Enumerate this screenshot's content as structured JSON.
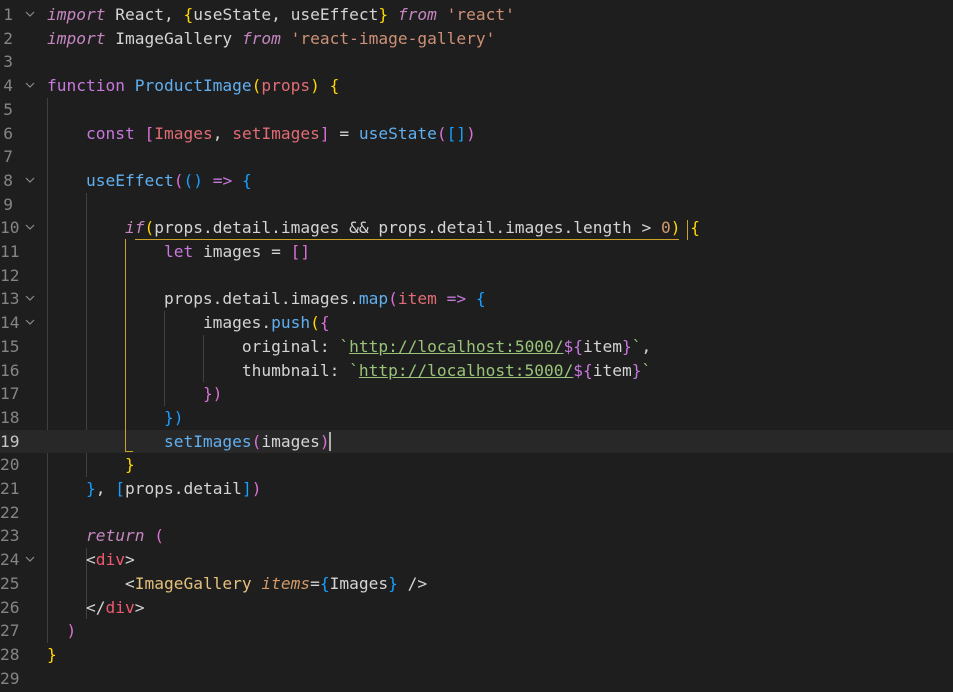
{
  "editor": {
    "language": "javascript-react",
    "active_line": 19,
    "line_numbers": [
      "1",
      "2",
      "3",
      "4",
      "5",
      "6",
      "7",
      "8",
      "9",
      "10",
      "11",
      "12",
      "13",
      "14",
      "15",
      "16",
      "17",
      "18",
      "19",
      "20",
      "21",
      "22",
      "23",
      "24",
      "25",
      "26",
      "27",
      "28",
      "29"
    ],
    "fold_markers": [
      1,
      4,
      8,
      10,
      13,
      14,
      24
    ],
    "lines": [
      [
        [
          "import",
          "kw"
        ],
        [
          " React, ",
          "plain"
        ],
        [
          "{",
          "br1"
        ],
        [
          "useState, useEffect",
          "plain"
        ],
        [
          "}",
          "br1"
        ],
        [
          " ",
          "plain"
        ],
        [
          "from",
          "kw"
        ],
        [
          " ",
          "plain"
        ],
        [
          "'react'",
          "str"
        ]
      ],
      [
        [
          "import",
          "kw"
        ],
        [
          " ImageGallery ",
          "plain"
        ],
        [
          "from",
          "kw"
        ],
        [
          " ",
          "plain"
        ],
        [
          "'react-image-gallery'",
          "str"
        ]
      ],
      [],
      [
        [
          "function",
          "let"
        ],
        [
          " ",
          "plain"
        ],
        [
          "ProductImage",
          "fn2"
        ],
        [
          "(",
          "br1"
        ],
        [
          "props",
          "param"
        ],
        [
          ")",
          "br1"
        ],
        [
          " ",
          "plain"
        ],
        [
          "{",
          "br1"
        ]
      ],
      [],
      [
        [
          "    ",
          "plain"
        ],
        [
          "const",
          "let"
        ],
        [
          " ",
          "plain"
        ],
        [
          "[",
          "br2"
        ],
        [
          "Images",
          "param"
        ],
        [
          ", ",
          "plain"
        ],
        [
          "setImages",
          "param"
        ],
        [
          "]",
          "br2"
        ],
        [
          " = ",
          "plain"
        ],
        [
          "useState",
          "fn2"
        ],
        [
          "(",
          "br2"
        ],
        [
          "[]",
          "br3"
        ],
        [
          ")",
          "br2"
        ]
      ],
      [],
      [
        [
          "    ",
          "plain"
        ],
        [
          "useEffect",
          "fn2"
        ],
        [
          "(",
          "br2"
        ],
        [
          "()",
          "br3"
        ],
        [
          " => ",
          "let"
        ],
        [
          "{",
          "br3"
        ]
      ],
      [],
      [
        [
          "        ",
          "plain"
        ],
        [
          "if",
          "kw"
        ],
        [
          "(",
          "br1"
        ],
        [
          "props.detail.images && props.detail.images.length > ",
          "plain"
        ],
        [
          "0",
          "num"
        ],
        [
          ")",
          "br1"
        ],
        [
          " ",
          "plain"
        ],
        [
          "{",
          "br1"
        ]
      ],
      [
        [
          "            ",
          "plain"
        ],
        [
          "let",
          "let"
        ],
        [
          " images = ",
          "plain"
        ],
        [
          "[]",
          "br2"
        ]
      ],
      [],
      [
        [
          "            ",
          "plain"
        ],
        [
          "props.detail.images.",
          "plain"
        ],
        [
          "map",
          "fn2"
        ],
        [
          "(",
          "br2"
        ],
        [
          "item",
          "param"
        ],
        [
          " => ",
          "let"
        ],
        [
          "{",
          "br3"
        ]
      ],
      [
        [
          "                ",
          "plain"
        ],
        [
          "images.",
          "plain"
        ],
        [
          "push",
          "fn2"
        ],
        [
          "(",
          "br1"
        ],
        [
          "{",
          "br2"
        ]
      ],
      [
        [
          "                    ",
          "plain"
        ],
        [
          "original: ",
          "plain"
        ],
        [
          "`",
          "tpl"
        ],
        [
          "http://localhost:5000/",
          "url"
        ],
        [
          "${",
          "let"
        ],
        [
          "item",
          "plain"
        ],
        [
          "}",
          "let"
        ],
        [
          "`",
          "tpl"
        ],
        [
          ",",
          "plain"
        ]
      ],
      [
        [
          "                    ",
          "plain"
        ],
        [
          "thumbnail: ",
          "plain"
        ],
        [
          "`",
          "tpl"
        ],
        [
          "http://localhost:5000/",
          "url"
        ],
        [
          "${",
          "let"
        ],
        [
          "item",
          "plain"
        ],
        [
          "}",
          "let"
        ],
        [
          "`",
          "tpl"
        ]
      ],
      [
        [
          "                ",
          "plain"
        ],
        [
          "})",
          "br2"
        ]
      ],
      [
        [
          "            ",
          "plain"
        ],
        [
          "})",
          "br3"
        ]
      ],
      [
        [
          "            ",
          "plain"
        ],
        [
          "setImages",
          "fn2"
        ],
        [
          "(",
          "br2"
        ],
        [
          "images",
          "plain"
        ],
        [
          ")",
          "br2"
        ]
      ],
      [
        [
          "        ",
          "plain"
        ],
        [
          "}",
          "br1"
        ]
      ],
      [
        [
          "    ",
          "plain"
        ],
        [
          "}",
          "br3"
        ],
        [
          ", ",
          "plain"
        ],
        [
          "[",
          "br3"
        ],
        [
          "props.detail",
          "plain"
        ],
        [
          "]",
          "br3"
        ],
        [
          ")",
          "br2"
        ]
      ],
      [],
      [
        [
          "    ",
          "plain"
        ],
        [
          "return",
          "kw"
        ],
        [
          " ",
          "plain"
        ],
        [
          "(",
          "br2"
        ]
      ],
      [
        [
          "    ",
          "plain"
        ],
        [
          "<",
          "plain"
        ],
        [
          "div",
          "tag"
        ],
        [
          ">",
          "plain"
        ]
      ],
      [
        [
          "        ",
          "plain"
        ],
        [
          "<",
          "plain"
        ],
        [
          "ImageGallery",
          "comp"
        ],
        [
          " ",
          "plain"
        ],
        [
          "items",
          "attr"
        ],
        [
          "=",
          "plain"
        ],
        [
          "{",
          "br3"
        ],
        [
          "Images",
          "plain"
        ],
        [
          "}",
          "br3"
        ],
        [
          " />",
          "plain"
        ]
      ],
      [
        [
          "    ",
          "plain"
        ],
        [
          "</",
          "plain"
        ],
        [
          "div",
          "tag"
        ],
        [
          ">",
          "plain"
        ]
      ],
      [
        [
          "  ",
          "plain"
        ],
        [
          ")",
          "br2"
        ]
      ],
      [
        [
          "}",
          "br1"
        ]
      ],
      []
    ]
  }
}
